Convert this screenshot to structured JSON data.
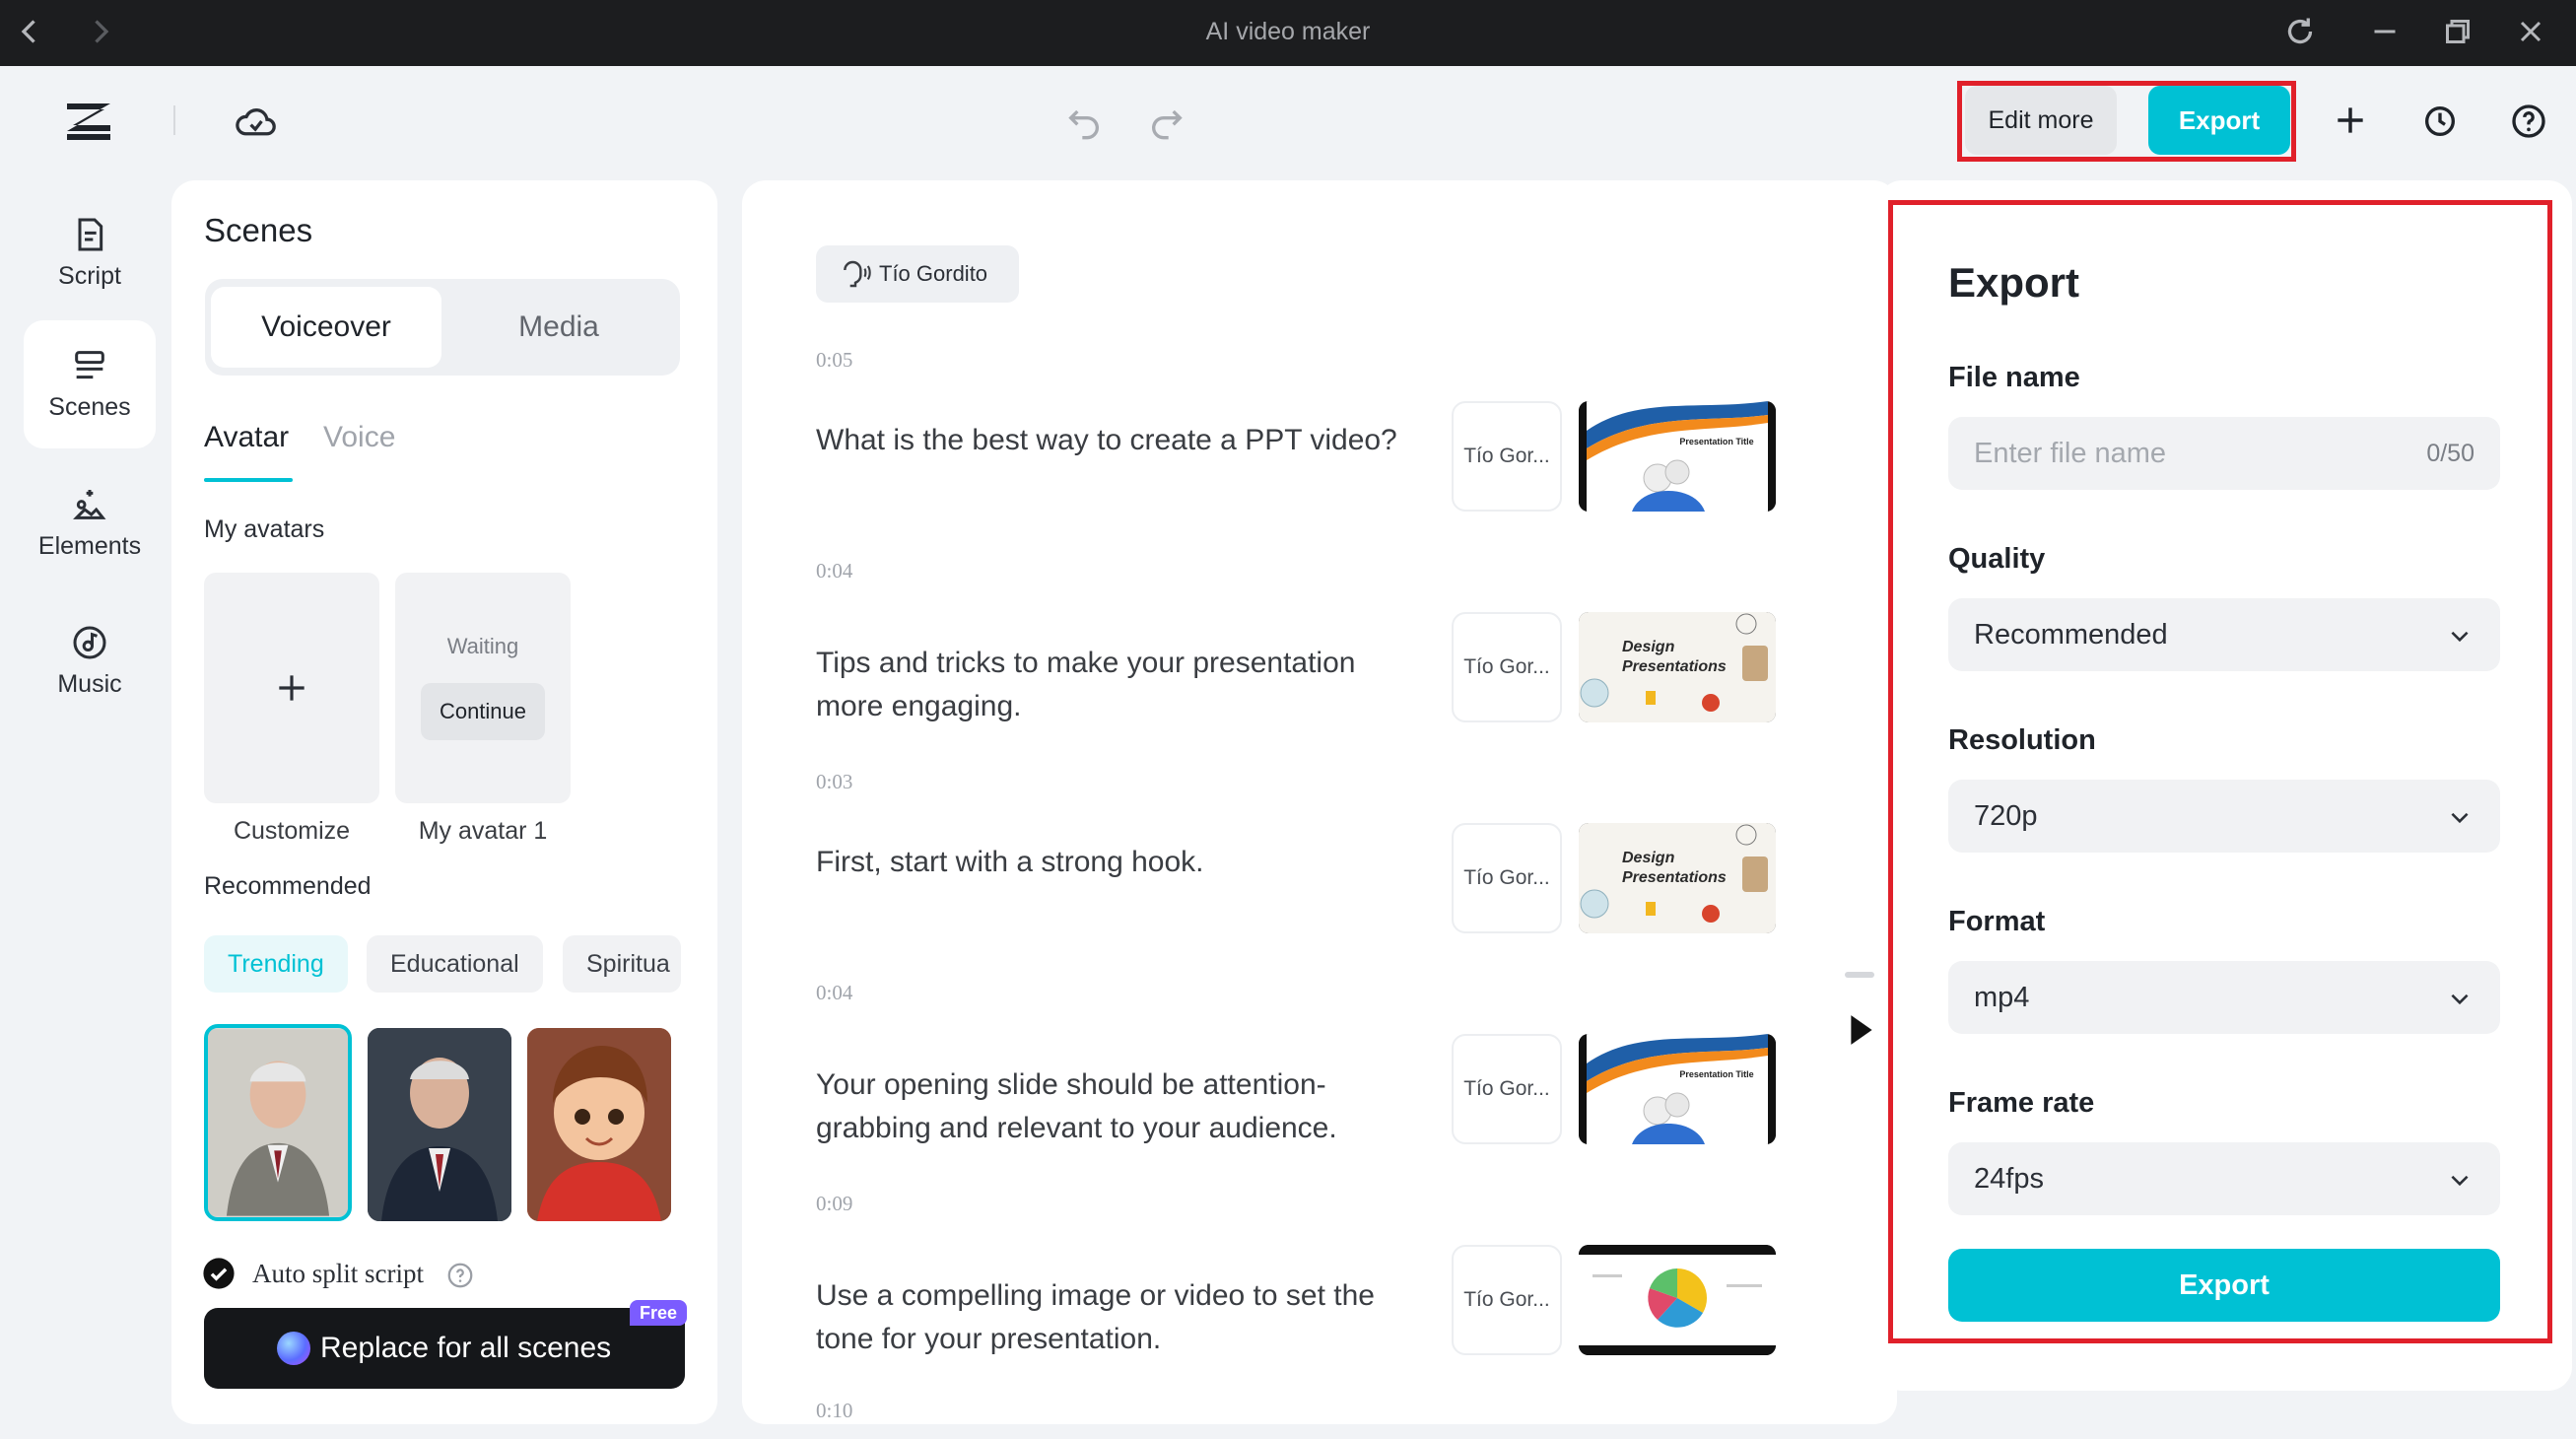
{
  "window": {
    "title": "AI video maker"
  },
  "toolbar": {
    "edit_more_label": "Edit more",
    "export_label": "Export"
  },
  "nav": {
    "items": [
      {
        "label": "Script",
        "icon": "script-icon"
      },
      {
        "label": "Scenes",
        "icon": "scenes-icon"
      },
      {
        "label": "Elements",
        "icon": "elements-icon"
      },
      {
        "label": "Music",
        "icon": "music-icon"
      }
    ]
  },
  "scenes_panel": {
    "title": "Scenes",
    "mode_tabs": [
      "Voiceover",
      "Media"
    ],
    "sub_tabs": [
      "Avatar",
      "Voice"
    ],
    "my_avatars_label": "My avatars",
    "customize_label": "Customize",
    "waiting_label": "Waiting",
    "continue_label": "Continue",
    "my_avatar_label": "My avatar 1",
    "recommended_label": "Recommended",
    "categories": [
      "Trending",
      "Educational",
      "Spiritua"
    ],
    "auto_split_label": "Auto split script",
    "replace_label": "Replace for all scenes",
    "free_badge": "Free"
  },
  "script": {
    "voice_chip": "Tío Gordito",
    "scenes": [
      {
        "time": "0:05",
        "text": "What is the best way to create a PPT video?",
        "avatar": "Tío Gor...",
        "thumb": "title",
        "thumb_time": "0:05"
      },
      {
        "time": "0:04",
        "text": "Tips and tricks to make your presentation more engaging.",
        "avatar": "Tío Gor...",
        "thumb": "design"
      },
      {
        "time": "0:03",
        "text": "First, start with a strong hook.",
        "avatar": "Tío Gor...",
        "thumb": "design"
      },
      {
        "time": "0:04",
        "text": "Your opening slide should be attention-grabbing and relevant to your audience.",
        "avatar": "Tío Gor...",
        "thumb": "title",
        "thumb_time": "0:04"
      },
      {
        "time": "0:09",
        "text": "Use a compelling image or video to set the tone for your presentation.",
        "avatar": "Tío Gor...",
        "thumb": "pie"
      }
    ],
    "last_time": "0:10",
    "thumb_title_text": "Presentation Title",
    "thumb_design_line1": "Design",
    "thumb_design_line2": "Presentations"
  },
  "export": {
    "title": "Export",
    "file_name_label": "File name",
    "file_name_placeholder": "Enter file name",
    "file_name_counter": "0/50",
    "quality_label": "Quality",
    "quality_value": "Recommended",
    "resolution_label": "Resolution",
    "resolution_value": "720p",
    "format_label": "Format",
    "format_value": "mp4",
    "frame_rate_label": "Frame rate",
    "frame_rate_value": "24fps",
    "export_button": "Export"
  },
  "colors": {
    "accent": "#00c1d4",
    "highlight": "#e0202a",
    "dark": "#1c1d1f"
  }
}
